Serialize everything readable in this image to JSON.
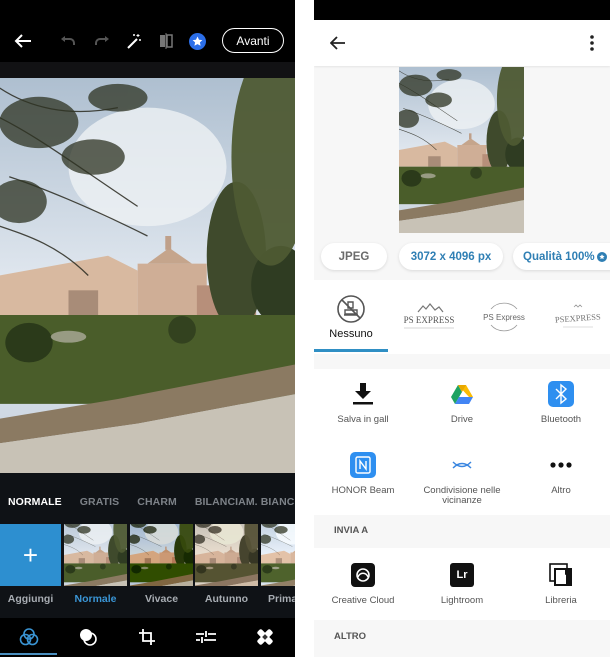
{
  "editor": {
    "topbar": {
      "back_icon": "arrow-left-icon",
      "undo_icon": "undo-icon",
      "redo_icon": "redo-icon",
      "auto_fix_icon": "magic-wand-icon",
      "compare_icon": "compare-icon",
      "premium_icon": "star-badge-icon",
      "next_label": "Avanti"
    },
    "filter_categories": [
      {
        "label": "NORMALE",
        "active": true
      },
      {
        "label": "GRATIS",
        "active": false
      },
      {
        "label": "CHARM",
        "active": false
      },
      {
        "label": "BILANCIAM. BIANCO",
        "active": false
      }
    ],
    "add_label": "Aggiungi",
    "add_icon": "+",
    "filters": [
      {
        "label": "Normale",
        "active": true
      },
      {
        "label": "Vivace",
        "active": false
      },
      {
        "label": "Autunno",
        "active": false
      },
      {
        "label": "Prima",
        "active": false
      }
    ],
    "tools": [
      {
        "name": "looks-icon",
        "active": true
      },
      {
        "name": "mask-blend-icon",
        "active": false
      },
      {
        "name": "crop-icon",
        "active": false
      },
      {
        "name": "adjust-sliders-icon",
        "active": false
      },
      {
        "name": "heal-bandage-icon",
        "active": false
      }
    ],
    "accent_color": "#2d8fd0"
  },
  "share": {
    "appbar": {
      "back_icon": "arrow-left-icon",
      "more_icon": "more-vertical-icon"
    },
    "chips": {
      "format": "JPEG",
      "resolution": "3072 x 4096 px",
      "quality": "Qualità 100%"
    },
    "watermarks": [
      {
        "label": "Nessuno",
        "active": true
      },
      {
        "text": "PS EXPRESS",
        "active": false
      },
      {
        "text": "PS Express",
        "active": false
      },
      {
        "text": "PSEXPRESS",
        "active": false
      }
    ],
    "share_targets": [
      {
        "label": "Salva in gall",
        "icon": "download-icon"
      },
      {
        "label": "Drive",
        "icon": "google-drive-icon"
      },
      {
        "label": "Bluetooth",
        "icon": "bluetooth-icon"
      },
      {
        "label": "HONOR Beam",
        "icon": "nfc-icon"
      },
      {
        "label": "Condivisione nelle vicinanze",
        "icon": "nearby-share-icon"
      },
      {
        "label": "Altro",
        "icon": "more-horizontal-icon"
      }
    ],
    "send_to_header": "INVIA A",
    "send_to": [
      {
        "label": "Creative Cloud",
        "icon": "creative-cloud-icon"
      },
      {
        "label": "Lightroom",
        "icon": "lightroom-icon",
        "badge": "Lr"
      },
      {
        "label": "Libreria",
        "icon": "library-icon"
      }
    ],
    "other_header": "ALTRO",
    "accent_color": "#2f7fb4"
  }
}
